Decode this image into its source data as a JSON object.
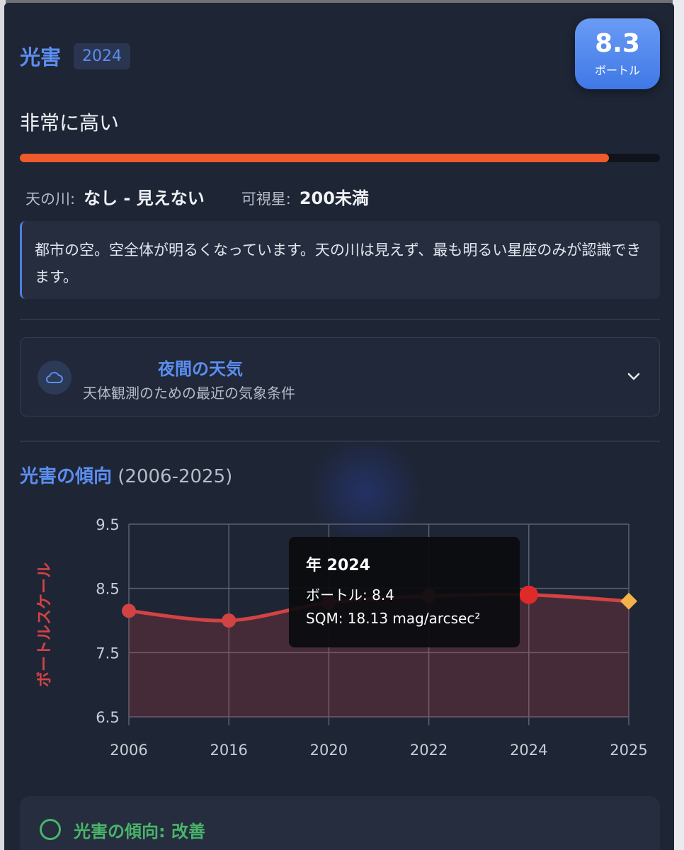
{
  "header": {
    "title": "光害",
    "year": "2024",
    "bortle_value": "8.3",
    "bortle_unit": "ボートル"
  },
  "level": {
    "text": "非常に高い",
    "fill_fraction": 0.92,
    "color": "#ef5a2c"
  },
  "stats": {
    "milkyway_label": "天の川:",
    "milkyway_value": "なし - 見えない",
    "stars_label": "可視星:",
    "stars_value": "200未満"
  },
  "description": "都市の空。空全体が明るくなっています。天の川は見えず、最も明るい星座のみが認識できます。",
  "weather": {
    "icon": "cloud-icon",
    "title": "夜間の天気",
    "subtitle": "天体観測のための最近の気象条件",
    "toggle_icon": "chevron-down-icon"
  },
  "trend": {
    "title": "光害の傾向",
    "range": "(2006-2025)"
  },
  "chart_data": {
    "type": "line",
    "categories": [
      "2006",
      "2016",
      "2020",
      "2022",
      "2024",
      "2025"
    ],
    "series": [
      {
        "values": [
          8.15,
          8.0,
          8.28,
          8.38,
          8.4,
          8.3
        ],
        "color": "#d24343"
      }
    ],
    "ylabel": "ボートルスケール",
    "ylim": [
      6.5,
      9.5
    ],
    "yticks": [
      "9.5",
      "8.5",
      "7.5",
      "6.5"
    ],
    "grid": true,
    "highlighted_index": 4,
    "last_point_color": "#f3b14c"
  },
  "tooltip": {
    "title": "年 2024",
    "bortle_line": "ボートル:  8.4",
    "sqm_line": "SQM: 18.13 mag/arcsec²"
  },
  "status": {
    "text": "光害の傾向: 改善",
    "color": "#49b46a"
  }
}
